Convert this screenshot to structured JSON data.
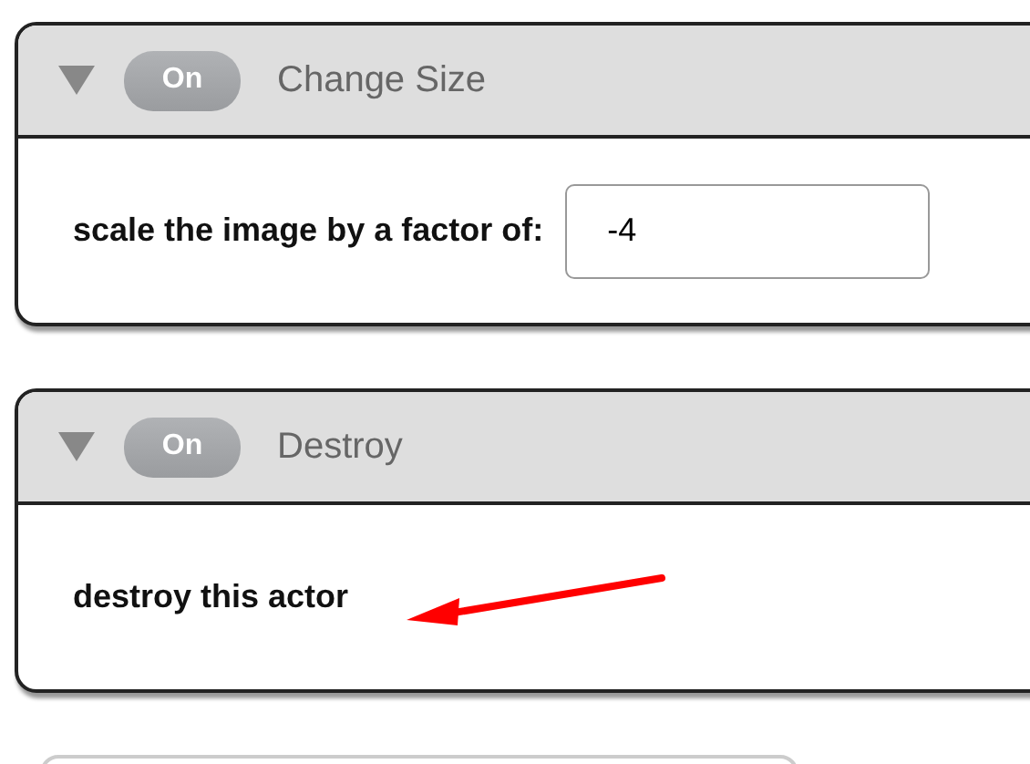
{
  "behaviors": [
    {
      "kind": "field",
      "expanded": true,
      "toggle": "On",
      "on": true,
      "title": "Change Size",
      "label": "scale the image by a factor of:",
      "value": "-4",
      "arrow": false
    },
    {
      "kind": "text",
      "expanded": true,
      "toggle": "On",
      "on": true,
      "title": "Destroy",
      "label": "destroy this actor",
      "arrow": true
    }
  ]
}
